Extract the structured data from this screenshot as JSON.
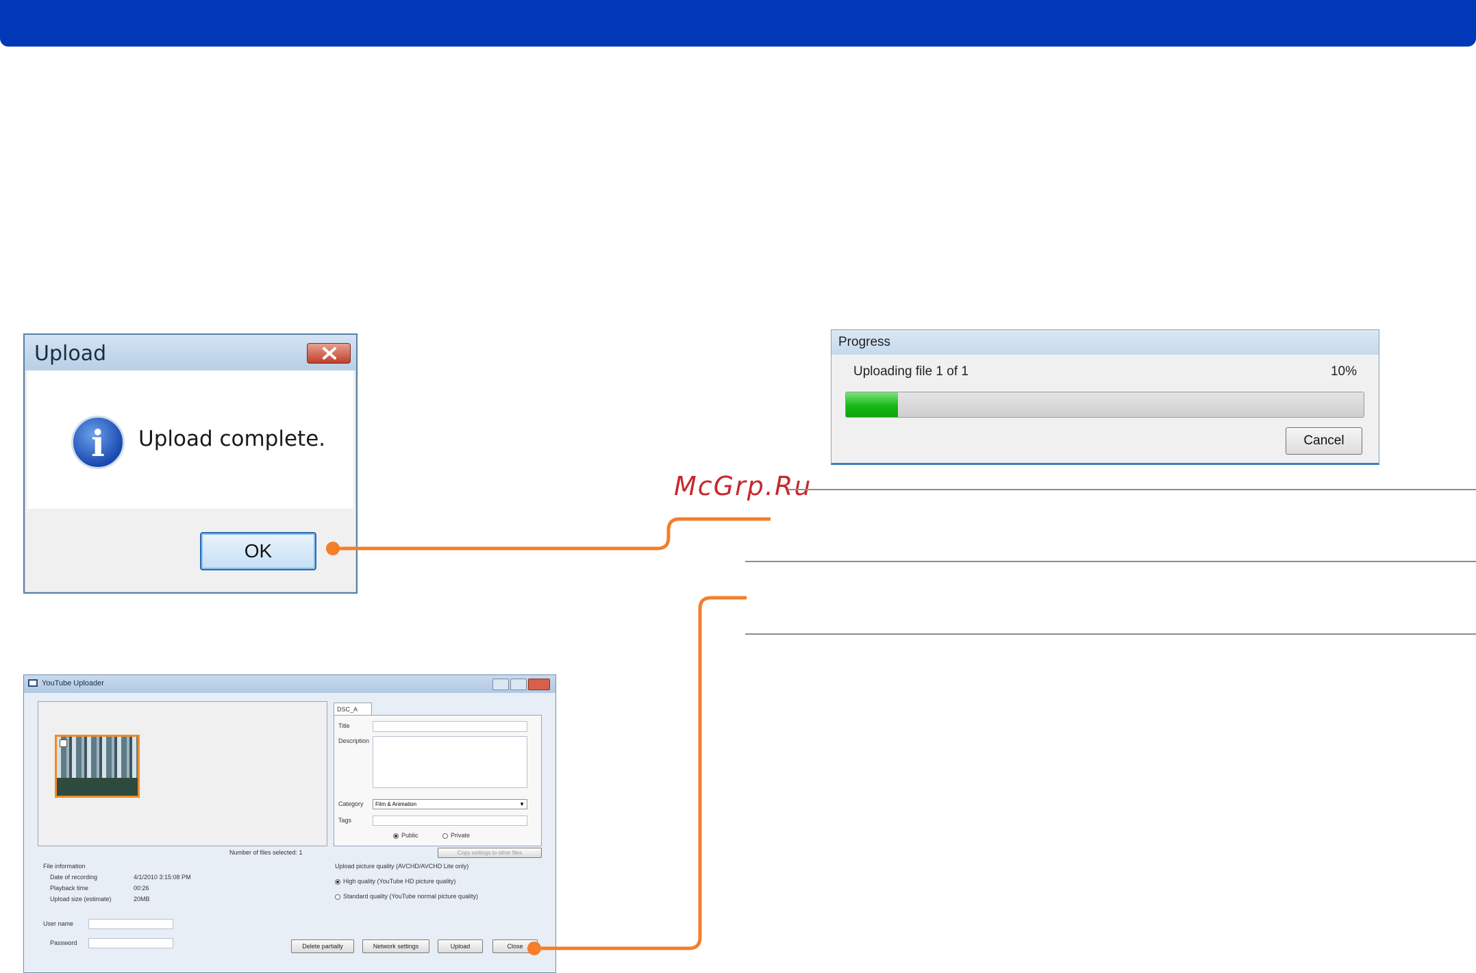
{
  "upload_dialog": {
    "title": "Upload",
    "message": "Upload complete.",
    "ok_label": "OK",
    "icon": "info-icon",
    "close_icon": "close-icon"
  },
  "progress_dialog": {
    "title": "Progress",
    "status": "Uploading file 1 of 1",
    "percent_label": "10%",
    "progress": 0.1,
    "cancel_label": "Cancel"
  },
  "watermark": "McGrp.Ru",
  "youtube_uploader": {
    "title": "YouTube Uploader",
    "tab": "DSC_A",
    "files_selected": "Number of files selected: 1",
    "file_info": {
      "heading": "File information",
      "rows": [
        {
          "label": "Date of recording",
          "value": "4/1/2010 3:15:08 PM"
        },
        {
          "label": "Playback time",
          "value": "00:26"
        },
        {
          "label": "Upload size (estimate)",
          "value": "20MB"
        }
      ]
    },
    "fields": {
      "title_label": "Title",
      "description_label": "Description",
      "category_label": "Category",
      "category_value": "Film & Animation",
      "tags_label": "Tags",
      "public_label": "Public",
      "private_label": "Private",
      "copy_settings": "Copy settings to other files"
    },
    "quality": {
      "heading": "Upload picture quality (AVCHD/AVCHD Lite only)",
      "high": "High quality (YouTube HD picture quality)",
      "standard": "Standard quality (YouTube normal picture quality)"
    },
    "login": {
      "user_label": "User name",
      "password_label": "Password"
    },
    "buttons": {
      "delete": "Delete partially",
      "network": "Network settings",
      "upload": "Upload",
      "close": "Close"
    }
  },
  "colors": {
    "header_bar": "#0038b8",
    "connector": "#f47e2a",
    "progress_fill": "#15b815",
    "watermark": "#c8282c"
  }
}
